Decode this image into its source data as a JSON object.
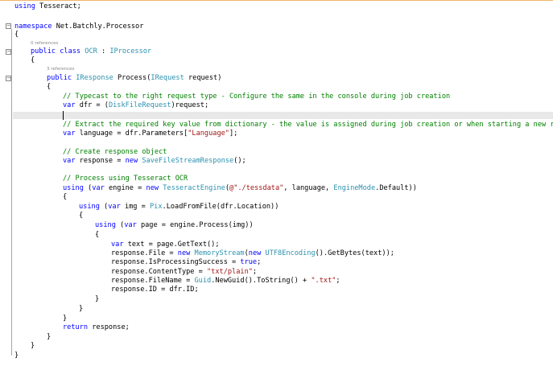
{
  "editor": {
    "line_using": [
      "using",
      " Tesseract;"
    ],
    "ns_keyword": "namespace",
    "ns_name": " Net.Batchly.Processor",
    "brace_open": "{",
    "brace_close": "}",
    "refs_class": "0 references",
    "class_line": [
      "public",
      " ",
      "class",
      " ",
      "OCR",
      " : ",
      "IProcessor"
    ],
    "refs_method": "3 references",
    "method_line": [
      "public",
      " ",
      "IResponse",
      " Process(",
      "IRequest",
      " request)"
    ],
    "comment_typecast": "// Typecast to the right request type - Configure the same in the console during job creation",
    "dfr_line": [
      "var",
      " dfr = (",
      "DiskFileRequest",
      ")request;"
    ],
    "comment_extract": "// Extract the required key value from dictionary - the value is assigned during job creation or when starting a new run",
    "language_line": [
      "var",
      " language = dfr.Parameters[",
      "\"Language\"",
      "];"
    ],
    "comment_response": "// Create response object",
    "response_line": [
      "var",
      " response = ",
      "new",
      " ",
      "SaveFileStreamResponse",
      "();"
    ],
    "comment_process": "// Process using Tesseract OCR",
    "engine_line": [
      "using",
      " (",
      "var",
      " engine = ",
      "new",
      " ",
      "TesseractEngine",
      "(",
      "@\"./tessdata\"",
      ", language, ",
      "EngineMode",
      ".Default))"
    ],
    "img_line": [
      "using",
      " (",
      "var",
      " img = ",
      "Pix",
      ".LoadFromFile(dfr.Location))"
    ],
    "page_line": [
      "using",
      " (",
      "var",
      " page = engine.Process(img))"
    ],
    "text_line": [
      "var",
      " text = page.GetText();"
    ],
    "file_line": [
      "response.File = ",
      "new",
      " ",
      "MemoryStream",
      "(",
      "new",
      " ",
      "UTF8Encoding",
      "().GetBytes(text));"
    ],
    "success_line": [
      "response.IsProcessingSuccess = ",
      "true",
      ";"
    ],
    "ctype_line": [
      "response.ContentType = ",
      "\"txt/plain\"",
      ";"
    ],
    "fname_line": [
      "response.FileName = ",
      "Guid",
      ".NewGuid().ToString() + ",
      "\".txt\"",
      ";"
    ],
    "id_line": "response.ID = dfr.ID;",
    "return_line": [
      "return",
      " response;"
    ],
    "fold_minus": "−"
  },
  "colors": {
    "keyword": "#0000ff",
    "type": "#2b91af",
    "string": "#a31515",
    "comment": "#008000",
    "current_line": "#e8e8e8"
  }
}
